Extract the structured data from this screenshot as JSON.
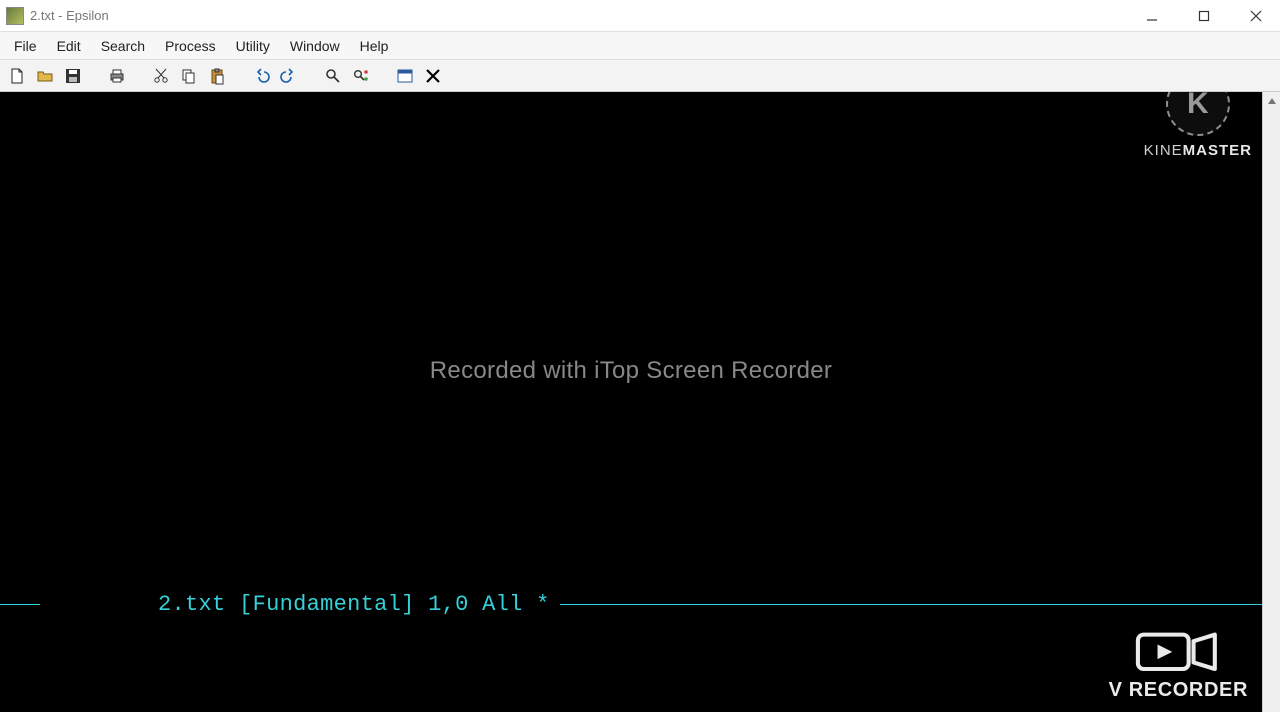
{
  "window": {
    "title": "2.txt - Epsilon"
  },
  "menu": {
    "items": [
      "File",
      "Edit",
      "Search",
      "Process",
      "Utility",
      "Window",
      "Help"
    ]
  },
  "toolbar": {
    "icons": {
      "new": "new-file-icon",
      "open": "open-file-icon",
      "save": "save-icon",
      "print": "print-icon",
      "cut": "cut-icon",
      "copy": "copy-icon",
      "paste": "paste-icon",
      "undo": "undo-icon",
      "redo": "redo-icon",
      "find": "find-icon",
      "find_replace": "find-replace-icon",
      "panel": "panel-icon",
      "close": "close-x-icon"
    }
  },
  "editor": {
    "center_watermark": "Recorded with iTop Screen Recorder",
    "modeline": {
      "file": "2.txt",
      "mode": "[Fundamental]",
      "position": "1,0",
      "extent": "All",
      "modified": "*"
    }
  },
  "watermarks": {
    "kinemaster": {
      "logo_letter": "K",
      "label_light": "KINE",
      "label_bold": "MASTER"
    },
    "vrecorder": {
      "label": "V RECORDER"
    }
  },
  "colors": {
    "modeline": "#35d0d8",
    "editor_bg": "#000000"
  }
}
